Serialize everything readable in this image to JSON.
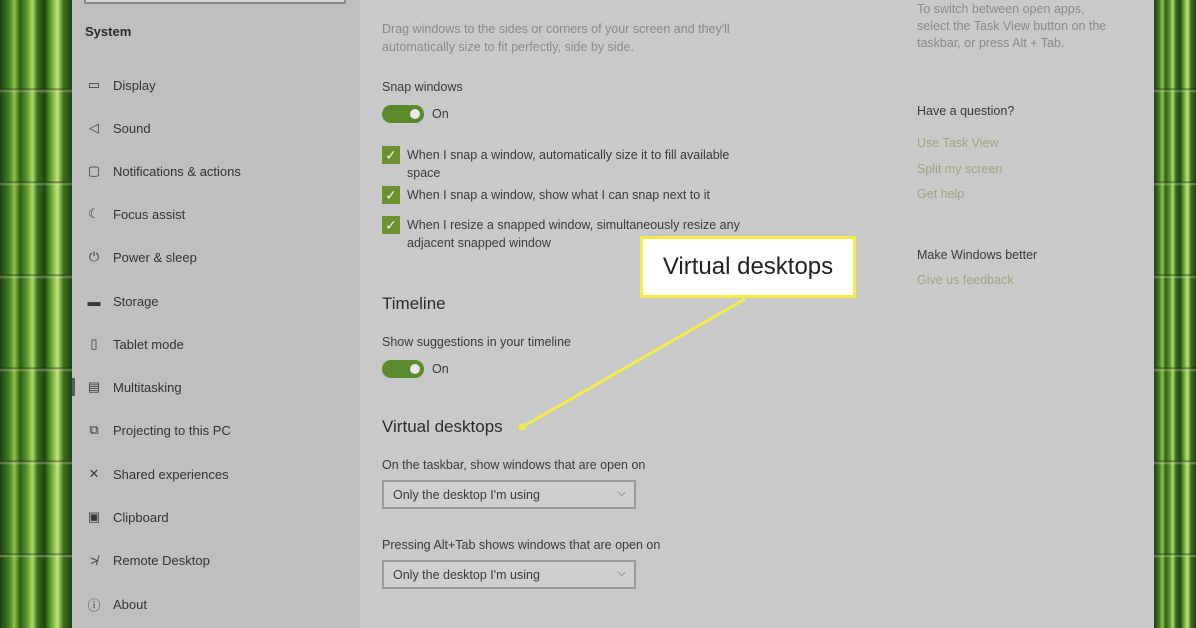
{
  "sidebar": {
    "section_title": "System",
    "items": [
      {
        "label": "Display",
        "icon": "display-icon",
        "glyph": "▭"
      },
      {
        "label": "Sound",
        "icon": "speaker-icon",
        "glyph": "◁"
      },
      {
        "label": "Notifications & actions",
        "icon": "notification-icon",
        "glyph": "▢"
      },
      {
        "label": "Focus assist",
        "icon": "moon-icon",
        "glyph": "☾"
      },
      {
        "label": "Power & sleep",
        "icon": "power-icon",
        "glyph": "⏻"
      },
      {
        "label": "Storage",
        "icon": "storage-icon",
        "glyph": "▬"
      },
      {
        "label": "Tablet mode",
        "icon": "tablet-icon",
        "glyph": "▯"
      },
      {
        "label": "Multitasking",
        "icon": "multitasking-icon",
        "glyph": "▤"
      },
      {
        "label": "Projecting to this PC",
        "icon": "projector-icon",
        "glyph": "⧉"
      },
      {
        "label": "Shared experiences",
        "icon": "shared-icon",
        "glyph": "✕"
      },
      {
        "label": "Clipboard",
        "icon": "clipboard-icon",
        "glyph": "▣"
      },
      {
        "label": "Remote Desktop",
        "icon": "remote-icon",
        "glyph": "≯"
      },
      {
        "label": "About",
        "icon": "info-icon",
        "glyph": "ⓘ"
      }
    ]
  },
  "main": {
    "snap_description_line1": "Drag windows to the sides or corners of your screen and they'll",
    "snap_description_line2": "automatically size to fit perfectly, side by side.",
    "snap_label": "Snap windows",
    "snap_toggle_state": "On",
    "check1_line1": "When I snap a window, automatically size it to fill available",
    "check1_line2": "space",
    "check2": "When I snap a window, show what I can snap next to it",
    "check3_line1": "When I resize a snapped window, simultaneously resize any",
    "check3_line2": "adjacent snapped window",
    "timeline_heading": "Timeline",
    "timeline_label": "Show suggestions in your timeline",
    "timeline_toggle_state": "On",
    "vd_heading": "Virtual desktops",
    "vd_taskbar_label": "On the taskbar, show windows that are open on",
    "vd_taskbar_value": "Only the desktop I'm using",
    "vd_alttab_label": "Pressing Alt+Tab shows windows that are open on",
    "vd_alttab_value": "Only the desktop I'm using"
  },
  "right": {
    "tip_line1": "To switch between open apps,",
    "tip_line2": "select the Task View button on the",
    "tip_line3": "taskbar, or press Alt + Tab.",
    "question_heading": "Have a question?",
    "links": [
      "Use Task View",
      "Split my screen",
      "Get help"
    ],
    "better_heading": "Make Windows better",
    "feedback_link": "Give us feedback"
  },
  "callout": {
    "text": "Virtual desktops",
    "color": "#f2ec4a"
  },
  "colors": {
    "accent": "#5a8a2c",
    "checkbox": "#6a9330"
  }
}
